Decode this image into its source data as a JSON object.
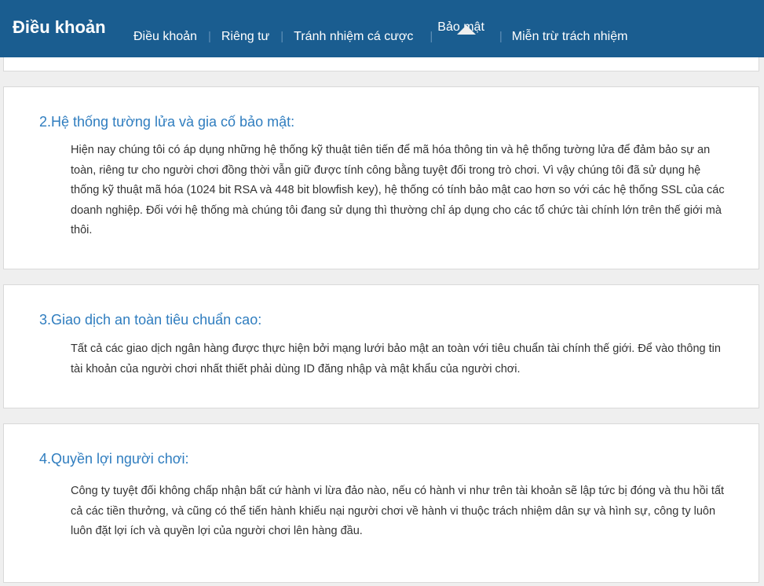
{
  "header": {
    "brand": "Điều khoản",
    "nav": [
      {
        "label": "Điều khoản",
        "active": false
      },
      {
        "label": "Riêng tư",
        "active": false
      },
      {
        "label": "Tránh nhiệm cá cược",
        "active": false
      },
      {
        "label": "Bảo mật",
        "active": true
      },
      {
        "label": "Miễn trừ trách nhiệm",
        "active": false
      }
    ],
    "separator": "|"
  },
  "sections": [
    {
      "title": "2.Hệ thống tường lửa và gia cố bảo mật:",
      "body": "Hiện nay chúng tôi có áp dụng những hệ thống kỹ thuật tiên tiến để mã hóa thông tin và hệ thống tường lửa để đảm bảo sự an toàn, riêng tư cho người chơi đồng thời vẫn giữ được tính công bằng tuyệt đối trong trò chơi. Vì vậy chúng tôi đã sử dụng hệ thống kỹ thuật mã hóa (1024 bit RSA và 448 bit blowfish key), hệ thống có tính bảo mật cao hơn so với các hệ thống SSL của các doanh nghiệp. Đối với hệ thống mà chúng tôi đang sử dụng thì thường chỉ áp dụng cho các tổ chức tài chính lớn trên thế giới mà thôi."
    },
    {
      "title": "3.Giao dịch an toàn tiêu chuẩn cao:",
      "body": "Tất cả các giao dịch ngân hàng được thực hiện bởi mạng lưới bảo mật an toàn với tiêu chuẩn tài chính thế giới. Để vào thông tin tài khoản của người chơi nhất thiết phải dùng ID đăng nhập và mật khẩu của người chơi."
    },
    {
      "title": "4.Quyền lợi người chơi:",
      "body": "Công ty tuyệt đối không chấp nhận bất cứ hành vi lừa đảo nào, nếu có hành vi như trên tài khoản sẽ lập tức bị đóng và thu hồi tất cả các tiền thưởng, và cũng có thể tiến hành khiếu nại người chơi về hành vi thuộc trách nhiệm dân sự và hình sự, công ty luôn luôn đặt lợi ích và quyền lợi của người chơi lên hàng đầu."
    }
  ],
  "colors": {
    "header_bg": "#1a5d90",
    "title": "#2f7dbf",
    "body_text": "#333333",
    "page_bg": "#efefef"
  }
}
